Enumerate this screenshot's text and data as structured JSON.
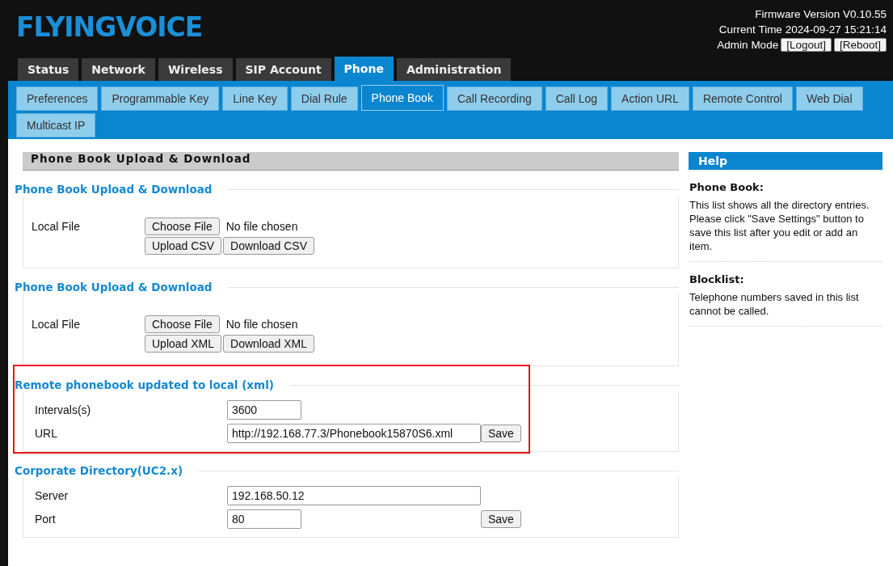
{
  "logo": "FLYINGVOICE",
  "header": {
    "firmware": "Firmware Version V0.10.55",
    "time": "Current Time 2024-09-27 15:21:14",
    "mode": "Admin Mode",
    "buttons": [
      "[Logout]",
      "[Reboot]"
    ]
  },
  "tabs": [
    {
      "label": "Status",
      "selected": false
    },
    {
      "label": "Network",
      "selected": false
    },
    {
      "label": "Wireless",
      "selected": false
    },
    {
      "label": "SIP Account",
      "selected": false
    },
    {
      "label": "Phone",
      "selected": true
    },
    {
      "label": "Administration",
      "selected": false
    }
  ],
  "subtabs": [
    {
      "label": "Preferences",
      "selected": false
    },
    {
      "label": "Programmable Key",
      "selected": false
    },
    {
      "label": "Line Key",
      "selected": false
    },
    {
      "label": "Dial Rule",
      "selected": false
    },
    {
      "label": "Phone Book",
      "selected": true
    },
    {
      "label": "Call Recording",
      "selected": false
    },
    {
      "label": "Call Log",
      "selected": false
    },
    {
      "label": "Action URL",
      "selected": false
    },
    {
      "label": "Remote Control",
      "selected": false
    },
    {
      "label": "Web Dial",
      "selected": false
    },
    {
      "label": "Multicast IP",
      "selected": false
    }
  ],
  "section_title": "Phone Book Upload & Download",
  "groups": [
    {
      "kind": "file",
      "title": "Phone Book Upload & Download",
      "highlighted": false,
      "label": "Local File",
      "choose": "Choose File",
      "status": "No file chosen",
      "buttons": [
        "Upload CSV",
        "Download CSV"
      ]
    },
    {
      "kind": "file",
      "title": "Phone Book Upload & Download",
      "highlighted": false,
      "label": "Local File",
      "choose": "Choose File",
      "status": "No file chosen",
      "buttons": [
        "Upload XML",
        "Download XML"
      ]
    },
    {
      "kind": "fields",
      "title": "Remote phonebook updated to local (xml)",
      "highlighted": true,
      "rows": [
        {
          "label": "Intervals(s)",
          "value": "3600",
          "kind": "short"
        },
        {
          "label": "URL",
          "value": "http://192.168.77.3/Phonebook15870S6.xml",
          "kind": "long",
          "button": "Save"
        }
      ]
    },
    {
      "kind": "fields",
      "title": "Corporate Directory(UC2.x)",
      "highlighted": false,
      "rows": [
        {
          "label": "Server",
          "value": "192.168.50.12",
          "kind": "long"
        },
        {
          "label": "Port",
          "value": "80",
          "kind": "short",
          "button": "Save"
        }
      ]
    }
  ],
  "help": {
    "title": "Help",
    "entries": [
      {
        "heading": "Phone Book:",
        "lines": [
          "This list shows all the directory entries.",
          "Please click \"Save Settings\" button to save this list after you edit or add an item."
        ]
      },
      {
        "heading": "Blocklist:",
        "lines": [
          "Telephone numbers saved in this list cannot be called."
        ]
      }
    ]
  }
}
